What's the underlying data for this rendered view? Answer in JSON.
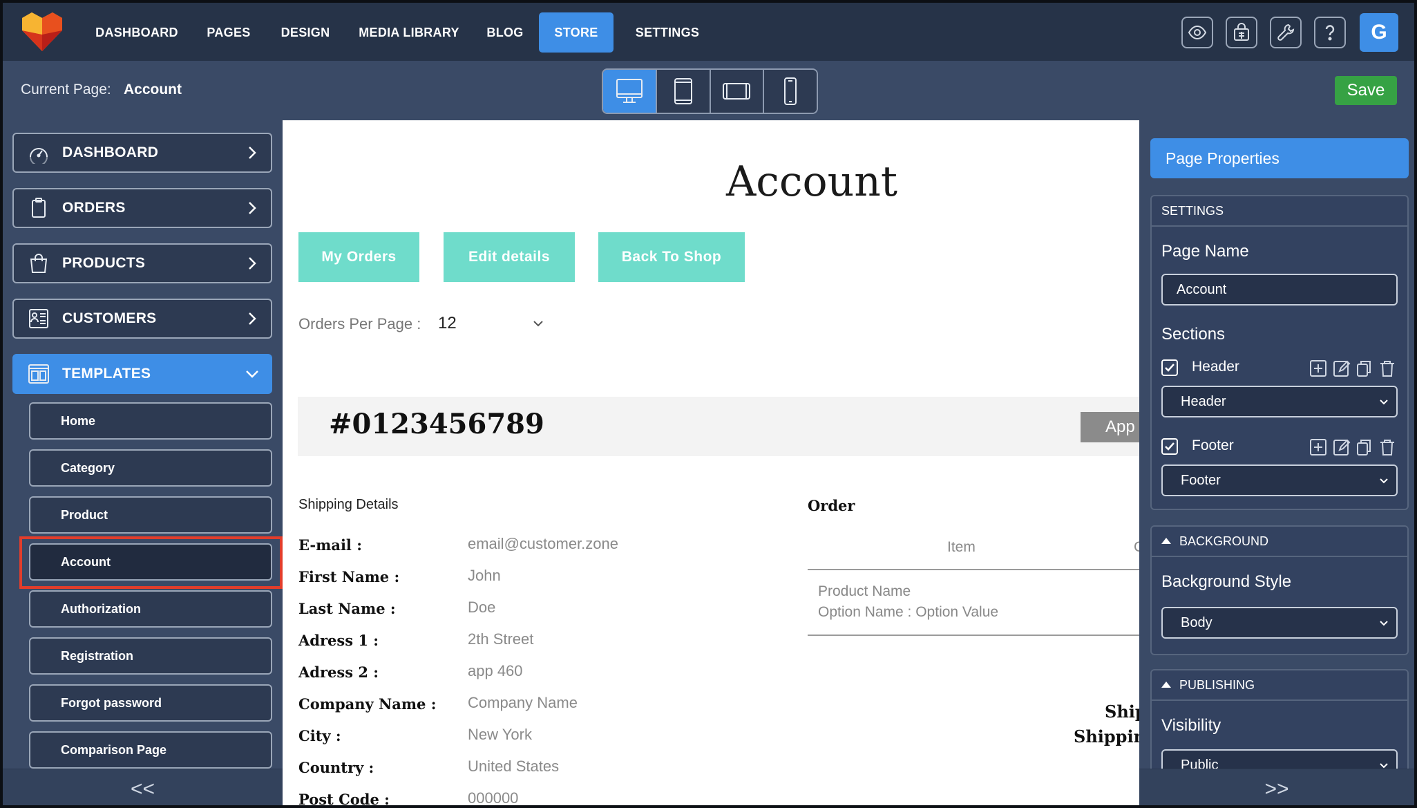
{
  "nav": {
    "items": [
      "DASHBOARD",
      "PAGES",
      "DESIGN",
      "MEDIA LIBRARY",
      "BLOG",
      "STORE",
      "SETTINGS"
    ],
    "active": "STORE",
    "avatar": "G",
    "accent_color": "#3e8ee6"
  },
  "subbar": {
    "current_page_label": "Current Page:",
    "current_page_value": "Account",
    "devices": [
      "desktop",
      "tablet-portrait",
      "tablet-landscape",
      "mobile"
    ],
    "active_device": "desktop",
    "save_label": "Save",
    "save_color": "#36a244"
  },
  "sidebar": {
    "main_items": [
      {
        "label": "DASHBOARD",
        "icon": "gauge-icon"
      },
      {
        "label": "ORDERS",
        "icon": "clipboard-icon"
      },
      {
        "label": "PRODUCTS",
        "icon": "shopping-bag-icon"
      },
      {
        "label": "CUSTOMERS",
        "icon": "contacts-icon"
      },
      {
        "label": "TEMPLATES",
        "icon": "layout-icon"
      }
    ],
    "templates": [
      "Home",
      "Category",
      "Product",
      "Account",
      "Authorization",
      "Registration",
      "Forgot password",
      "Comparison Page"
    ],
    "selected_template": "Account",
    "collapse_label": "<<"
  },
  "canvas": {
    "title": "Account",
    "buttons": [
      "My Orders",
      "Edit details",
      "Back To Shop"
    ],
    "orders_per_page_label": "Orders Per Page :",
    "orders_per_page_value": "12",
    "order_number": "#0123456789",
    "order_status_partial": "App",
    "shipping": {
      "heading": "Shipping Details",
      "rows": [
        {
          "label": "E-mail :",
          "value": "email@customer.zone"
        },
        {
          "label": "First Name :",
          "value": "John"
        },
        {
          "label": "Last Name :",
          "value": "Doe"
        },
        {
          "label": "Adress 1 :",
          "value": "2th Street"
        },
        {
          "label": "Adress 2 :",
          "value": "app 460"
        },
        {
          "label": "Company Name :",
          "value": "Company Name"
        },
        {
          "label": "City :",
          "value": "New York"
        },
        {
          "label": "Country :",
          "value": "United States"
        },
        {
          "label": "Post Code :",
          "value": "000000"
        }
      ]
    },
    "order": {
      "heading": "Order",
      "col_item": "Item",
      "col_partial": "C",
      "product_name": "Product Name",
      "option_line": "Option Name : Option Value",
      "summary_1": "Ship",
      "summary_2": "Shippin"
    }
  },
  "panel": {
    "page_properties_label": "Page Properties",
    "settings_header": "SETTINGS",
    "page_name_label": "Page Name",
    "page_name_value": "Account",
    "sections_label": "Sections",
    "header_check_label": "Header",
    "header_select_value": "Header",
    "footer_check_label": "Footer",
    "footer_select_value": "Footer",
    "background_header": "BACKGROUND",
    "background_style_label": "Background Style",
    "background_style_value": "Body",
    "publishing_header": "PUBLISHING",
    "visibility_label": "Visibility",
    "visibility_value": "Public",
    "expand_label": ">>"
  }
}
